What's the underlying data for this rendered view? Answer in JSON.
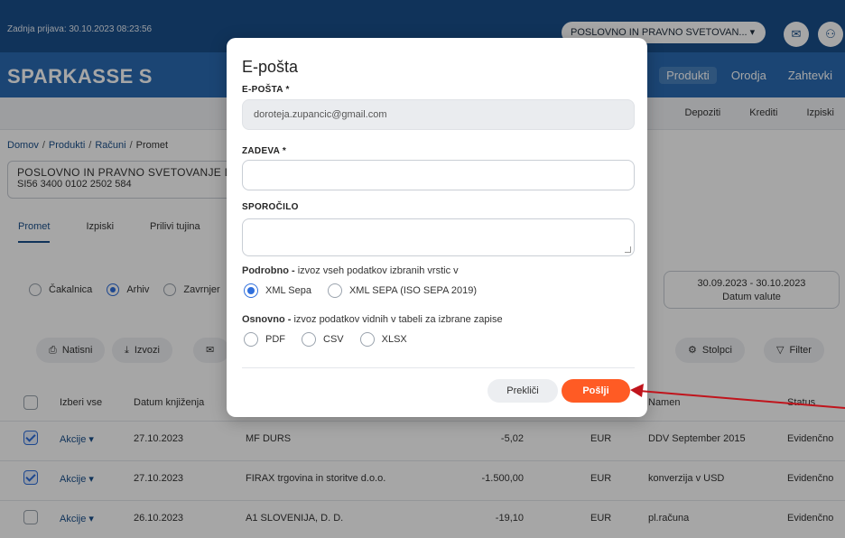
{
  "header": {
    "last_login": "Zadnja prijava: 30.10.2023 08:23:56",
    "account_select": "POSLOVNO IN PRAVNO SVETOVAN... ▾",
    "mail_icon": "✉",
    "user_icon": "⚇"
  },
  "brand": {
    "logo": "SPARKASSE",
    "logo_mark": "S",
    "nav": [
      "Produkti",
      "Orodja",
      "Zahtevki"
    ]
  },
  "subnav": [
    "Depoziti",
    "Krediti",
    "Izpiski"
  ],
  "breadcrumb": {
    "items": [
      "Domov",
      "Produkti",
      "Računi"
    ],
    "current": "Promet"
  },
  "account": {
    "name": "POSLOVNO IN PRAVNO SVETOVANJE D",
    "iban": "SI56 3400 0102 2502 584"
  },
  "tabs": [
    "Promet",
    "Izpiski",
    "Prilivi tujina"
  ],
  "filter_radios": {
    "items": [
      "Čakalnica",
      "Arhiv",
      "Zavrnjer"
    ],
    "selected": "Arhiv"
  },
  "date_range": {
    "range": "30.09.2023 - 30.10.2023",
    "label": "Datum valute"
  },
  "actions": {
    "print": "Natisni",
    "export": "Izvozi",
    "columns": "Stolpci",
    "filter": "Filter"
  },
  "table": {
    "select_all": "Izberi vse",
    "headers": [
      "Datum knjiženja",
      "Namen",
      "Status"
    ],
    "rows": [
      {
        "checked": true,
        "action": "Akcije ▾",
        "date": "27.10.2023",
        "party": "MF DURS",
        "amount": "-5,02",
        "currency": "EUR",
        "purpose": "DDV September 2015",
        "status": "Evidenčno"
      },
      {
        "checked": true,
        "action": "Akcije ▾",
        "date": "27.10.2023",
        "party": "FIRAX trgovina in storitve d.o.o.",
        "amount": "-1.500,00",
        "currency": "EUR",
        "purpose": "konverzija v USD",
        "status": "Evidenčno"
      },
      {
        "checked": false,
        "action": "Akcije ▾",
        "date": "26.10.2023",
        "party": "A1 SLOVENIJA, D. D.",
        "amount": "-19,10",
        "currency": "EUR",
        "purpose": "pl.računa",
        "status": "Evidenčno"
      }
    ]
  },
  "modal": {
    "title": "E-pošta",
    "email_label": "E-POŠTA *",
    "email_value": "doroteja.zupancic@gmail.com",
    "subject_label": "ZADEVA *",
    "subject_value": "",
    "message_label": "SPOROČILO",
    "message_value": "",
    "detailed_title": "Podrobno -",
    "detailed_desc": " izvoz vseh podatkov izbranih vrstic v",
    "detailed_options": [
      "XML Sepa",
      "XML SEPA (ISO SEPA 2019)"
    ],
    "detailed_selected": "XML Sepa",
    "basic_title": "Osnovno -",
    "basic_desc": " izvoz podatkov vidnih v tabeli za izbrane zapise",
    "basic_options": [
      "PDF",
      "CSV",
      "XLSX"
    ],
    "cancel": "Prekliči",
    "send": "Pošlji"
  },
  "colors": {
    "topbar": "#1a4f8b",
    "brandbar": "#2a6bb3",
    "accent_radio": "#2f6fdc",
    "send_button": "#ff5b24",
    "annotation_arrow": "#c0141c"
  }
}
